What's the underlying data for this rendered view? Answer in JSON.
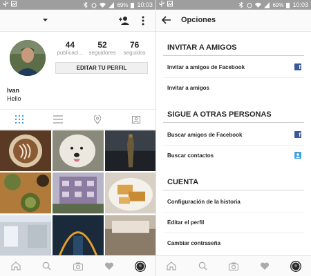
{
  "status_bar": {
    "battery": "69%",
    "time": "10:03"
  },
  "profile": {
    "stats": [
      {
        "number": "44",
        "label": "publicaci..."
      },
      {
        "number": "52",
        "label": "seguidores"
      },
      {
        "number": "76",
        "label": "seguidos"
      }
    ],
    "edit_button": "EDITAR TU PERFIL",
    "username": "Ivan",
    "bio": "Hello",
    "tabs": [
      "grid-view",
      "list-view",
      "location",
      "tagged"
    ]
  },
  "options": {
    "title": "Opciones",
    "sections": [
      {
        "header": "INVITAR A AMIGOS",
        "items": [
          {
            "label": "Invitar a amigos de Facebook",
            "icon": "facebook-icon"
          },
          {
            "label": "Invitar a amigos",
            "icon": ""
          }
        ]
      },
      {
        "header": "SIGUE A OTRAS PERSONAS",
        "items": [
          {
            "label": "Buscar amigos de Facebook",
            "icon": "facebook-icon"
          },
          {
            "label": "Buscar contactos",
            "icon": "contacts-icon"
          }
        ]
      },
      {
        "header": "CUENTA",
        "items": [
          {
            "label": "Configuración de la historia",
            "icon": ""
          },
          {
            "label": "Editar el perfil",
            "icon": ""
          },
          {
            "label": "Cambiar contraseña",
            "icon": ""
          }
        ]
      }
    ]
  },
  "bottom_nav": [
    "home-icon",
    "search-icon",
    "camera-icon",
    "heart-icon",
    "profile-icon"
  ],
  "colors": {
    "facebook": "#3b5998",
    "contacts": "#3fa1e4",
    "statusbar": "#9e9e9e"
  }
}
